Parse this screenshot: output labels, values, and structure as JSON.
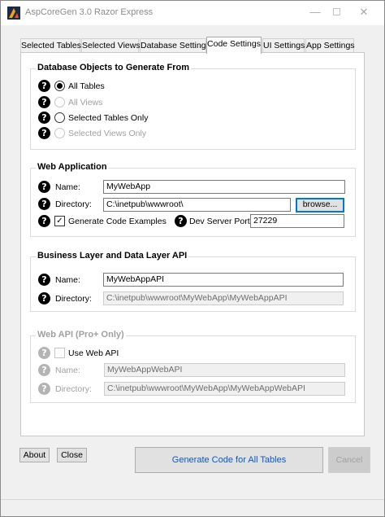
{
  "window": {
    "title": "AspCoreGen 3.0 Razor Express",
    "caption": {
      "minimize": "—",
      "close": "✕"
    }
  },
  "tabs": [
    {
      "label": "Selected Tables",
      "active": false
    },
    {
      "label": "Selected Views",
      "active": false
    },
    {
      "label": "Database Settings",
      "active": false
    },
    {
      "label": "Code Settings",
      "active": true
    },
    {
      "label": "UI Settings",
      "active": false
    },
    {
      "label": "App Settings",
      "active": false
    }
  ],
  "help_glyph": "?",
  "db_objects": {
    "heading": "Database Objects to Generate From",
    "options": [
      {
        "label": "All Tables",
        "checked": true,
        "enabled": true
      },
      {
        "label": "All Views",
        "checked": false,
        "enabled": false
      },
      {
        "label": "Selected Tables Only",
        "checked": false,
        "enabled": true
      },
      {
        "label": "Selected Views Only",
        "checked": false,
        "enabled": false
      }
    ]
  },
  "web_app": {
    "heading": "Web Application",
    "name_label": "Name:",
    "name_value": "MyWebApp",
    "dir_label": "Directory:",
    "dir_value": "C:\\inetpub\\wwwroot\\",
    "browse_label": "browse...",
    "gen_examples_label": "Generate Code Examples",
    "gen_examples_checked": true,
    "port_label": "Dev Server Port:",
    "port_value": "27229"
  },
  "business_layer": {
    "heading": "Business Layer and Data Layer API",
    "name_label": "Name:",
    "name_value": "MyWebAppAPI",
    "dir_label": "Directory:",
    "dir_value": "C:\\inetpub\\wwwroot\\MyWebApp\\MyWebAppAPI"
  },
  "web_api": {
    "heading": "Web API (Pro+ Only)",
    "use_label": "Use Web API",
    "use_checked": false,
    "name_label": "Name:",
    "name_value": "MyWebAppWebAPI",
    "dir_label": "Directory:",
    "dir_value": "C:\\inetpub\\wwwroot\\MyWebApp\\MyWebAppWebAPI"
  },
  "footer": {
    "about_label": "About",
    "close_label": "Close",
    "generate_label": "Generate Code for All Tables",
    "cancel_label": "Cancel"
  },
  "colors": {
    "accent": "#0078d7",
    "primary_text": "#0a58c4",
    "disabled_text": "#a0a0a0"
  }
}
